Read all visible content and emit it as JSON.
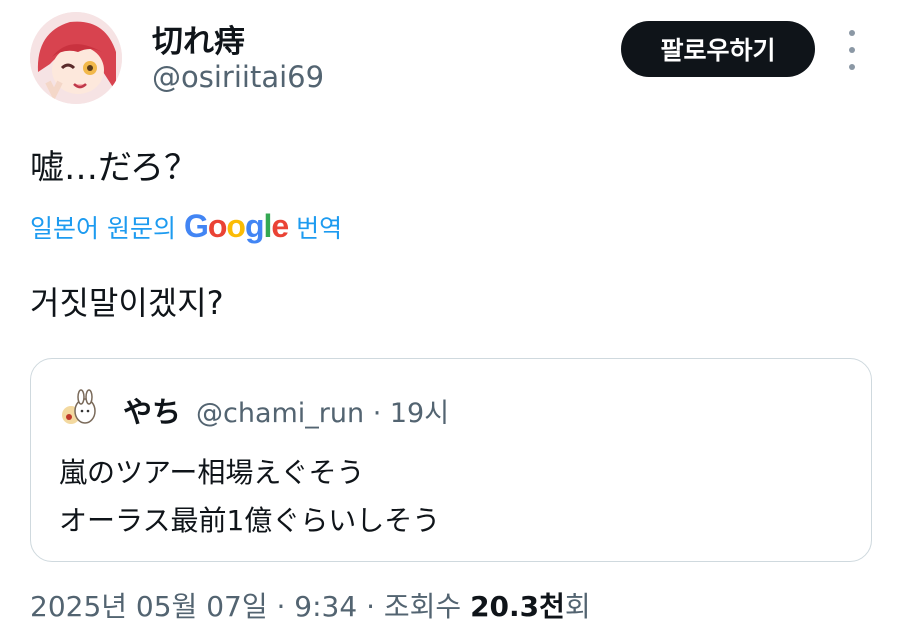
{
  "author": {
    "display_name": "切れ痔",
    "handle": "@osiriitai69"
  },
  "follow_label": "팔로우하기",
  "more_icon": "more-vertical-icon",
  "tweet": {
    "text": "嘘…だろ？",
    "translate_prefix": "일본어 원문의",
    "translate_brand": "Google",
    "translate_suffix": "번역",
    "translated_text": "거짓말이겠지?"
  },
  "quote": {
    "name": "やち",
    "meta": "@chami_run · 19시",
    "lines": [
      "嵐のツアー相場えぐそう",
      "オーラス最前1億ぐらいしそう"
    ]
  },
  "footer": {
    "prefix": "2025년 05월 07일 · 9:34 · 조회수 ",
    "views": "20.3천",
    "suffix": "회"
  },
  "colors": {
    "accent": "#1d9bf0",
    "text": "#0f1419",
    "muted": "#536471",
    "follow_bg": "#0f1419"
  }
}
